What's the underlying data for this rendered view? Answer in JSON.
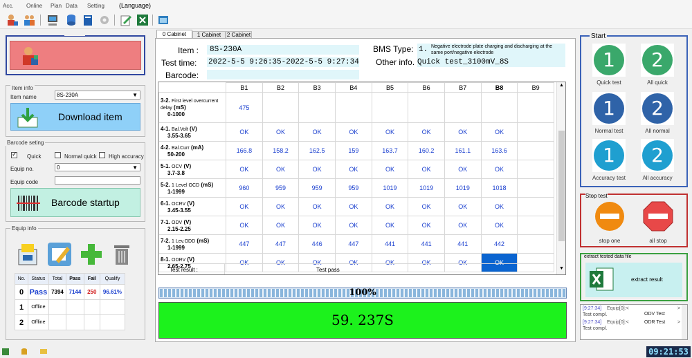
{
  "menu": [
    "Acc.",
    "Online",
    "Plan",
    "Data",
    "Setting",
    "(Language)"
  ],
  "tabs": [
    "0 Cabinet",
    "1 Cabinet",
    "2 Cabinet"
  ],
  "info": {
    "item_label": "Item :",
    "item_value": "8S-230A",
    "time_label": "Test time:",
    "time_value": "2022-5-5 9:26:35-2022-5-5 9:27:34",
    "barcode_label": "Barcode:",
    "barcode_value": "",
    "bms_label": "BMS Type:",
    "bms_value": "1.",
    "bms_desc": "Negative electrode plate charging and discharging at the same port/negative electrode",
    "other_label": "Other info.",
    "other_value": "Quick test_3100mV_8S"
  },
  "grid": {
    "columns": [
      "B1",
      "B2",
      "B3",
      "B4",
      "B5",
      "B6",
      "B7",
      "B8",
      "B9"
    ],
    "rows": [
      {
        "code": "3-2.",
        "name": "First level overcurrent delay",
        "unit": "(mS)",
        "range": "0-1000",
        "values": [
          "475",
          "",
          "",
          "",
          "",
          "",
          "",
          "",
          ""
        ]
      },
      {
        "code": "4-1.",
        "name": "Bal.Volt",
        "unit": "(V)",
        "range": "3.55-3.65",
        "values": [
          "OK",
          "OK",
          "OK",
          "OK",
          "OK",
          "OK",
          "OK",
          "OK",
          ""
        ]
      },
      {
        "code": "4-2.",
        "name": "Bal.Curr",
        "unit": "(mA)",
        "range": "50-200",
        "values": [
          "166.8",
          "158.2",
          "162.5",
          "159",
          "163.7",
          "160.2",
          "161.1",
          "163.6",
          ""
        ]
      },
      {
        "code": "5-1.",
        "name": "OCV",
        "unit": "(V)",
        "range": "3.7-3.8",
        "values": [
          "OK",
          "OK",
          "OK",
          "OK",
          "OK",
          "OK",
          "OK",
          "OK",
          ""
        ]
      },
      {
        "code": "5-2.",
        "name": "1 Level OCD",
        "unit": "(mS)",
        "range": "1-1999",
        "values": [
          "960",
          "959",
          "959",
          "959",
          "1019",
          "1019",
          "1019",
          "1018",
          ""
        ]
      },
      {
        "code": "6-1.",
        "name": "OCRV",
        "unit": "(V)",
        "range": "3.45-3.55",
        "values": [
          "OK",
          "OK",
          "OK",
          "OK",
          "OK",
          "OK",
          "OK",
          "OK",
          ""
        ]
      },
      {
        "code": "7-1.",
        "name": "ODV",
        "unit": "(V)",
        "range": "2.15-2.25",
        "values": [
          "OK",
          "OK",
          "OK",
          "OK",
          "OK",
          "OK",
          "OK",
          "OK",
          ""
        ]
      },
      {
        "code": "7-2.",
        "name": "1 Lev.ODD",
        "unit": "(mS)",
        "range": "1-1999",
        "values": [
          "447",
          "447",
          "446",
          "447",
          "441",
          "441",
          "441",
          "442",
          ""
        ]
      },
      {
        "code": "8-1.",
        "name": "ODRV",
        "unit": "(V)",
        "range": "2.65-2.75",
        "values": [
          "OK",
          "OK",
          "OK",
          "OK",
          "OK",
          "OK",
          "OK",
          "OK",
          ""
        ]
      }
    ],
    "result_label": "Test result  :",
    "result_value": "Test pass"
  },
  "progress": {
    "text": "100%",
    "fraction": 1.0
  },
  "timer": "59. 237S",
  "left": {
    "item_info_title": "Item info",
    "item_name_label": "Item name",
    "item_name_value": "8S-230A",
    "download_label": "Download item",
    "barcode_title": "Barcode seting",
    "quick": "Quick",
    "normal_quick": "Normal quick",
    "high_accuracy": "High accuracy",
    "equip_no_label": "Equip no.",
    "equip_no_value": "0",
    "equip_code_label": "Equip code",
    "barcode_startup": "Barcode startup",
    "equip_info_title": "Equip info",
    "table_headers": [
      "No.",
      "Status",
      "Total",
      "Pass",
      "Fail",
      "Qualify"
    ],
    "table_rows": [
      {
        "no": "0",
        "status": "Pass",
        "total": "7394",
        "pass": "7144",
        "fail": "250",
        "qualify": "96.61%"
      },
      {
        "no": "1",
        "status": "Offline",
        "total": "",
        "pass": "",
        "fail": "",
        "qualify": ""
      },
      {
        "no": "2",
        "status": "Offline",
        "total": "",
        "pass": "",
        "fail": "",
        "qualify": ""
      }
    ]
  },
  "right": {
    "start_title": "Start",
    "buttons": [
      {
        "num": "1",
        "label": "Quick test",
        "color": "#3aa86b"
      },
      {
        "num": "2",
        "label": "All quick",
        "color": "#3aa86b"
      },
      {
        "num": "1",
        "label": "Normal test",
        "color": "#2f63a8"
      },
      {
        "num": "2",
        "label": "All normal",
        "color": "#2f63a8"
      },
      {
        "num": "1",
        "label": "Accuracy test",
        "color": "#1f9fd0"
      },
      {
        "num": "2",
        "label": "All accuracy",
        "color": "#1f9fd0"
      }
    ],
    "stop_title": "Stop test",
    "stop_one": "stop one",
    "all_stop": "all stop",
    "extract_title": "extract tested data file",
    "extract_result": "extract result",
    "log": [
      {
        "time": "[9:27:34]",
        "text": "Equip[0]:<",
        "test": "ODV Test",
        "tail": ">",
        "sub": "Test compl."
      },
      {
        "time": "[9:27:34]",
        "text": "Equip[0]:<",
        "test": "ODR Test",
        "tail": ">",
        "sub": "Test compl."
      }
    ]
  },
  "status": {
    "clock": "09:21:53"
  }
}
